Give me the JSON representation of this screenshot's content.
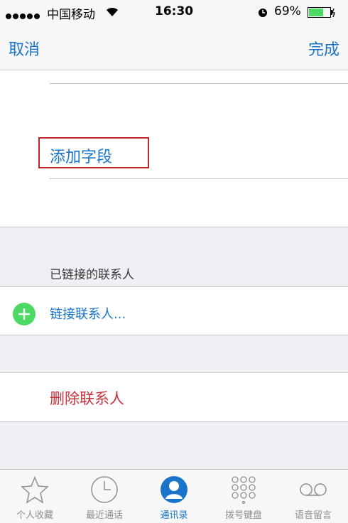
{
  "status_bar": {
    "carrier": "中国移动",
    "time": "16:30",
    "battery": "69%"
  },
  "nav": {
    "cancel": "取消",
    "done": "完成"
  },
  "form": {
    "add_field": "添加字段"
  },
  "linked": {
    "section_header": "已链接的联系人",
    "link_contact": "链接联系人..."
  },
  "delete_contact": "删除联系人",
  "tabbar": {
    "items": [
      {
        "label": "个人收藏",
        "icon": "star-icon"
      },
      {
        "label": "最近通话",
        "icon": "clock-icon"
      },
      {
        "label": "通讯录",
        "icon": "contacts-icon"
      },
      {
        "label": "拨号键盘",
        "icon": "keypad-icon"
      },
      {
        "label": "语音留言",
        "icon": "voicemail-icon"
      }
    ],
    "active_index": 2
  },
  "colors": {
    "accent": "#1a74c9",
    "destructive": "#c8323c",
    "add_green": "#4cd964",
    "highlight_box": "#c0252b"
  }
}
